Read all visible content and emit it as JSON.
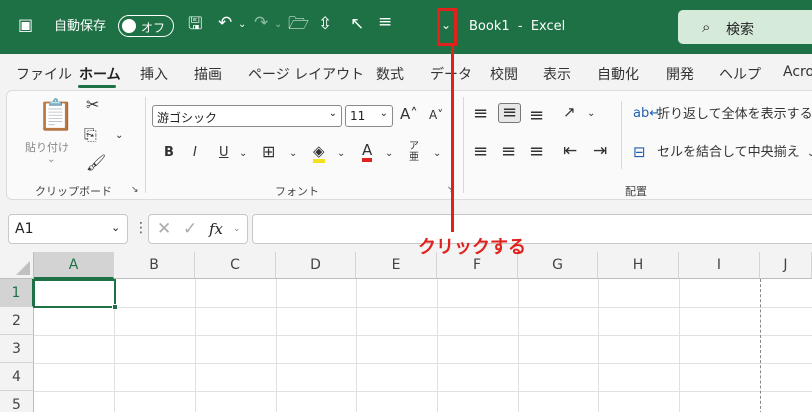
{
  "titlebar": {
    "autosave_label": "自動保存",
    "autosave_state": "オフ",
    "doc_title": "Book1  -  Excel",
    "search_label": "検索"
  },
  "menu": {
    "tabs": [
      "ファイル",
      "ホーム",
      "挿入",
      "描画",
      "ページ レイアウト",
      "数式",
      "データ",
      "校閲",
      "表示",
      "自動化",
      "開発",
      "ヘルプ",
      "Acro"
    ],
    "active": "ホーム"
  },
  "ribbon": {
    "clipboard": {
      "paste_label": "貼り付け",
      "group_label": "クリップボード"
    },
    "font": {
      "font_name": "游ゴシック",
      "font_size": "11",
      "bold": "B",
      "italic": "I",
      "underline": "U",
      "group_label": "フォント"
    },
    "alignment": {
      "wrap_label": "折り返して全体を表示する",
      "merge_label": "セルを結合して中央揃え",
      "group_label": "配置"
    }
  },
  "formula_bar": {
    "name_box": "A1",
    "fx": "fx",
    "value": ""
  },
  "grid": {
    "columns": [
      "A",
      "B",
      "C",
      "D",
      "E",
      "F",
      "G",
      "H",
      "I",
      "J"
    ],
    "rows": [
      "1",
      "2",
      "3",
      "4",
      "5"
    ],
    "selected_cell": "A1"
  },
  "annotation": {
    "text": "クリックする",
    "color": "#e0211c"
  },
  "colors": {
    "title_bar": "#1e7145",
    "accent": "#1e7145",
    "annotation": "#e0211c"
  }
}
